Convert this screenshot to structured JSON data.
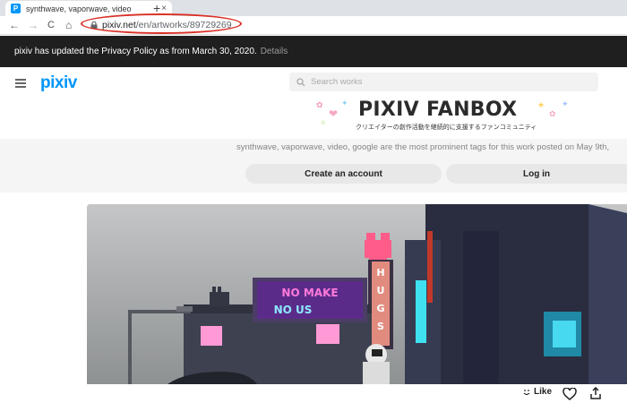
{
  "browser": {
    "tab_title": "synthwave, vaporwave, video",
    "tab_favicon": "P",
    "tab_close": "×",
    "new_tab": "+",
    "url_host": "pixiv.net",
    "url_path": "/en/artworks/89729269",
    "nav": {
      "back": "←",
      "forward": "→",
      "reload": "C",
      "home": "⌂"
    }
  },
  "banner": {
    "text": "pixiv has updated the Privacy Policy as from March 30, 2020.",
    "link": "Details"
  },
  "header": {
    "logo": "pixiv",
    "search_placeholder": "Search works"
  },
  "ad": {
    "title": "PIXIV FANBOX",
    "subtitle": "クリエイターの創作活動を継続的に支援するファンコミュニティ"
  },
  "work": {
    "description": "synthwave, vaporwave, video, google are the most prominent tags for this work posted on May 9th,",
    "create_account": "Create an account",
    "login": "Log in",
    "sign_left": "NO MAKE",
    "sign_left_2": "NO US",
    "sign_tall": "HUGS"
  },
  "actions": {
    "like": "Like"
  },
  "colors": {
    "pixiv_blue": "#0096fa",
    "banner_bg": "#1f1f1f",
    "highlight_red": "#d93025"
  }
}
